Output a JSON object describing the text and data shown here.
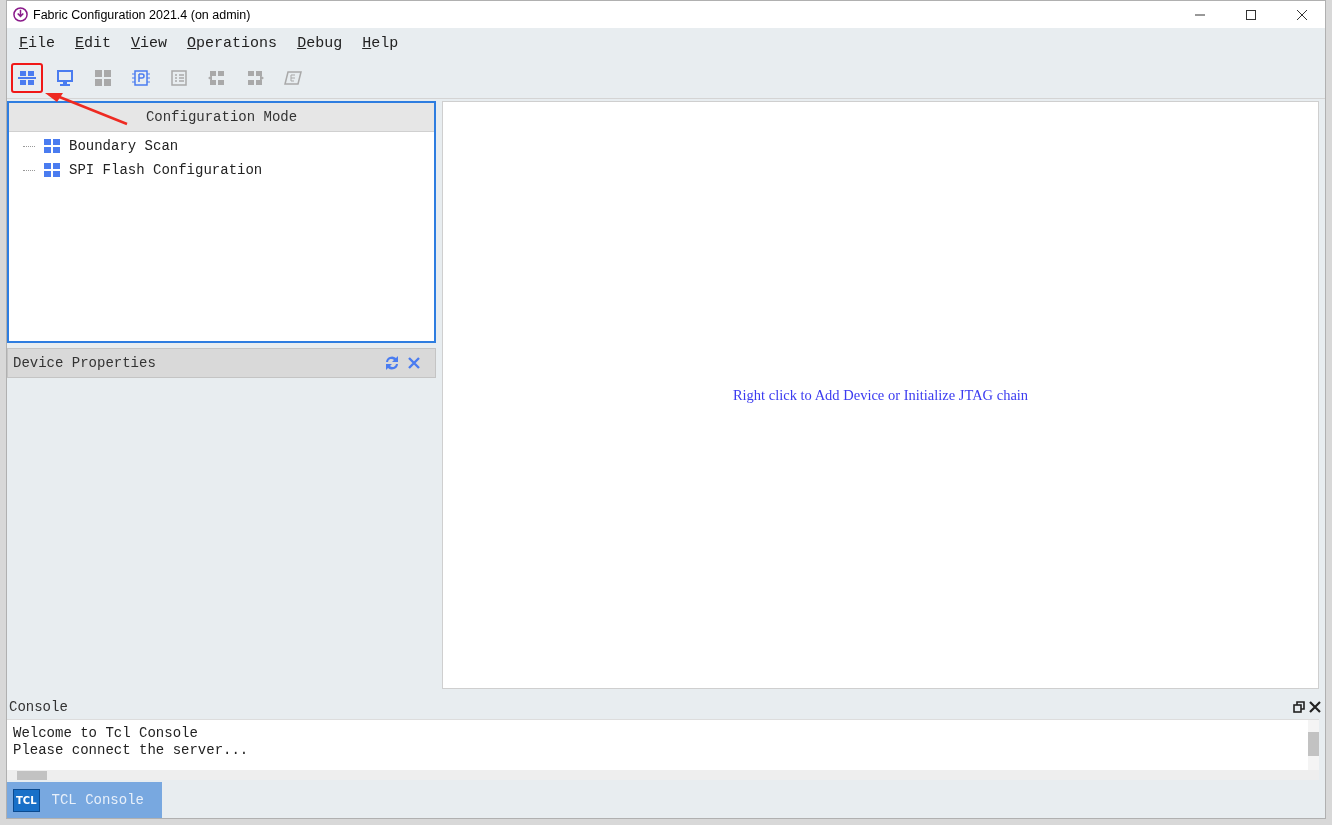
{
  "window": {
    "title": "Fabric Configuration 2021.4 (on admin)"
  },
  "menu": [
    {
      "label": "File"
    },
    {
      "label": "Edit"
    },
    {
      "label": "View"
    },
    {
      "label": "Operations"
    },
    {
      "label": "Debug"
    },
    {
      "label": "Help"
    }
  ],
  "toolbar": [
    {
      "kind": "chain",
      "disabled": false,
      "highlighted": true
    },
    {
      "kind": "monitor",
      "disabled": false,
      "highlighted": false
    },
    {
      "kind": "grid",
      "disabled": true,
      "highlighted": false
    },
    {
      "kind": "chip",
      "disabled": false,
      "highlighted": false
    },
    {
      "kind": "list",
      "disabled": true,
      "highlighted": false
    },
    {
      "kind": "left",
      "disabled": true,
      "highlighted": false
    },
    {
      "kind": "right",
      "disabled": true,
      "highlighted": false
    },
    {
      "kind": "eraser",
      "disabled": true,
      "highlighted": false
    }
  ],
  "configuration_mode": {
    "title": "Configuration Mode",
    "focused": true,
    "items": [
      {
        "label": "Boundary Scan"
      },
      {
        "label": "SPI Flash Configuration"
      }
    ]
  },
  "device_properties": {
    "title": "Device Properties"
  },
  "canvas": {
    "hint": "Right click to Add Device or Initialize JTAG chain"
  },
  "console": {
    "title": "Console",
    "lines": [
      "Welcome to Tcl Console",
      "Please connect the server..."
    ]
  },
  "bottom_tabs": [
    {
      "label": "TCL Console",
      "badge": "TCL",
      "selected": true
    }
  ]
}
